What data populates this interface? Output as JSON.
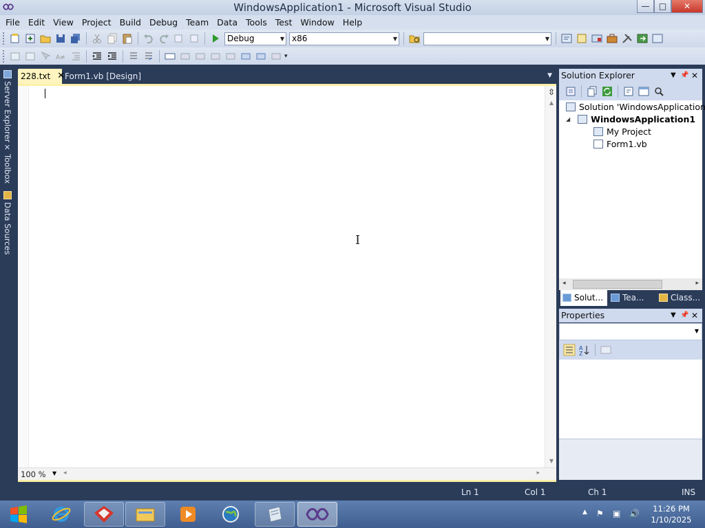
{
  "window": {
    "title": "WindowsApplication1 - Microsoft Visual Studio",
    "min_glyph": "—",
    "max_glyph": "□",
    "close_glyph": "✕"
  },
  "menu": {
    "items": [
      "File",
      "Edit",
      "View",
      "Project",
      "Build",
      "Debug",
      "Team",
      "Data",
      "Tools",
      "Test",
      "Window",
      "Help"
    ]
  },
  "toolbar": {
    "config": "Debug",
    "platform": "x86",
    "search_value": ""
  },
  "left_rail": {
    "tabs": [
      "Server Explorer",
      "Toolbox",
      "Data Sources"
    ]
  },
  "document_tabs": [
    {
      "label": "228.txt",
      "active": true
    },
    {
      "label": "Form1.vb [Design]",
      "active": false
    }
  ],
  "editor": {
    "zoom": "100 %"
  },
  "solution_explorer": {
    "title": "Solution Explorer",
    "tree": [
      {
        "label": "Solution 'WindowsApplication1'",
        "level": 0,
        "bold": false
      },
      {
        "label": "WindowsApplication1",
        "level": 1,
        "bold": true,
        "expanded": true
      },
      {
        "label": "My Project",
        "level": 2,
        "bold": false
      },
      {
        "label": "Form1.vb",
        "level": 2,
        "bold": false
      }
    ],
    "tabs": [
      "Solut...",
      "Tea...",
      "Class..."
    ]
  },
  "properties": {
    "title": "Properties",
    "selected_object": ""
  },
  "status": {
    "line": "Ln 1",
    "col": "Col 1",
    "ch": "Ch 1",
    "mode": "INS"
  },
  "taskbar": {
    "time": "11:26 PM",
    "date": "1/10/2025"
  },
  "colors": {
    "ide_background": "#2b3c59",
    "active_tab": "#fdf4bf",
    "taskbar": "#4a6a9c"
  }
}
